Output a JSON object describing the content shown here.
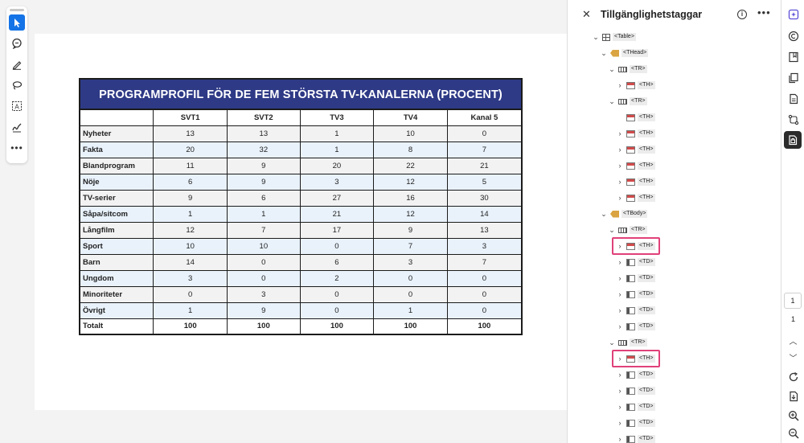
{
  "doc_table": {
    "title": "PROGRAMPROFIL FÖR DE FEM STÖRSTA TV-KANALERNA (PROCENT)",
    "columns": [
      "",
      "SVT1",
      "SVT2",
      "TV3",
      "TV4",
      "Kanal 5"
    ],
    "rows": [
      {
        "label": "Nyheter",
        "values": [
          "13",
          "13",
          "1",
          "10",
          "0"
        ]
      },
      {
        "label": "Fakta",
        "values": [
          "20",
          "32",
          "1",
          "8",
          "7"
        ]
      },
      {
        "label": "Blandprogram",
        "values": [
          "11",
          "9",
          "20",
          "22",
          "21"
        ]
      },
      {
        "label": "Nöje",
        "values": [
          "6",
          "9",
          "3",
          "12",
          "5"
        ]
      },
      {
        "label": "TV-serier",
        "values": [
          "9",
          "6",
          "27",
          "16",
          "30"
        ]
      },
      {
        "label": "Såpa/sitcom",
        "values": [
          "1",
          "1",
          "21",
          "12",
          "14"
        ]
      },
      {
        "label": "Långfilm",
        "values": [
          "12",
          "7",
          "17",
          "9",
          "13"
        ]
      },
      {
        "label": "Sport",
        "values": [
          "10",
          "10",
          "0",
          "7",
          "3"
        ]
      },
      {
        "label": "Barn",
        "values": [
          "14",
          "0",
          "6",
          "3",
          "7"
        ]
      },
      {
        "label": "Ungdom",
        "values": [
          "3",
          "0",
          "2",
          "0",
          "0"
        ]
      },
      {
        "label": "Minoriteter",
        "values": [
          "0",
          "3",
          "0",
          "0",
          "0"
        ]
      },
      {
        "label": "Övrigt",
        "values": [
          "1",
          "9",
          "0",
          "1",
          "0"
        ]
      },
      {
        "label": "Totalt",
        "values": [
          "100",
          "100",
          "100",
          "100",
          "100"
        ]
      }
    ]
  },
  "panel": {
    "title": "Tillgänglighetstaggar",
    "close_icon": "close-icon",
    "info_icon": "info-icon",
    "more_icon": "more-icon"
  },
  "tag_tree": [
    {
      "label": "<Table>",
      "icon": "table",
      "chev": "v",
      "depth": 0,
      "highlighted": false
    },
    {
      "label": "<THead>",
      "icon": "tag",
      "chev": "v",
      "depth": 1,
      "highlighted": false
    },
    {
      "label": "<TR>",
      "icon": "tr",
      "chev": "v",
      "depth": 2,
      "highlighted": false
    },
    {
      "label": "<TH>",
      "icon": "th",
      "chev": ">",
      "depth": 3,
      "highlighted": false
    },
    {
      "label": "<TR>",
      "icon": "tr",
      "chev": "v",
      "depth": 2,
      "highlighted": false
    },
    {
      "label": "<TH>",
      "icon": "th",
      "chev": "",
      "depth": 3,
      "highlighted": false
    },
    {
      "label": "<TH>",
      "icon": "th",
      "chev": ">",
      "depth": 3,
      "highlighted": false
    },
    {
      "label": "<TH>",
      "icon": "th",
      "chev": ">",
      "depth": 3,
      "highlighted": false
    },
    {
      "label": "<TH>",
      "icon": "th",
      "chev": ">",
      "depth": 3,
      "highlighted": false
    },
    {
      "label": "<TH>",
      "icon": "th",
      "chev": ">",
      "depth": 3,
      "highlighted": false
    },
    {
      "label": "<TH>",
      "icon": "th",
      "chev": ">",
      "depth": 3,
      "highlighted": false
    },
    {
      "label": "<TBody>",
      "icon": "tag",
      "chev": "v",
      "depth": 1,
      "highlighted": false
    },
    {
      "label": "<TR>",
      "icon": "tr",
      "chev": "v",
      "depth": 2,
      "highlighted": false
    },
    {
      "label": "<TH>",
      "icon": "th",
      "chev": ">",
      "depth": 3,
      "highlighted": true
    },
    {
      "label": "<TD>",
      "icon": "td",
      "chev": ">",
      "depth": 3,
      "highlighted": false
    },
    {
      "label": "<TD>",
      "icon": "td",
      "chev": ">",
      "depth": 3,
      "highlighted": false
    },
    {
      "label": "<TD>",
      "icon": "td",
      "chev": ">",
      "depth": 3,
      "highlighted": false
    },
    {
      "label": "<TD>",
      "icon": "td",
      "chev": ">",
      "depth": 3,
      "highlighted": false
    },
    {
      "label": "<TD>",
      "icon": "td",
      "chev": ">",
      "depth": 3,
      "highlighted": false
    },
    {
      "label": "<TR>",
      "icon": "tr",
      "chev": "v",
      "depth": 2,
      "highlighted": false
    },
    {
      "label": "<TH>",
      "icon": "th",
      "chev": ">",
      "depth": 3,
      "highlighted": true
    },
    {
      "label": "<TD>",
      "icon": "td",
      "chev": ">",
      "depth": 3,
      "highlighted": false
    },
    {
      "label": "<TD>",
      "icon": "td",
      "chev": ">",
      "depth": 3,
      "highlighted": false
    },
    {
      "label": "<TD>",
      "icon": "td",
      "chev": ">",
      "depth": 3,
      "highlighted": false
    },
    {
      "label": "<TD>",
      "icon": "td",
      "chev": ">",
      "depth": 3,
      "highlighted": false
    },
    {
      "label": "<TD>",
      "icon": "td",
      "chev": ">",
      "depth": 3,
      "highlighted": false
    }
  ],
  "left_tools": [
    "select-icon",
    "comment-icon",
    "pen-icon",
    "lasso-icon",
    "text-select-icon",
    "signature-icon",
    "more-tools-icon"
  ],
  "right_tools": [
    "ai-assistant-icon",
    "copy-icon",
    "bookmark-icon",
    "pages-icon",
    "document-icon",
    "transform-icon",
    "accessibility-tags-icon"
  ],
  "pager": {
    "current": "1",
    "total": "1"
  },
  "colors": {
    "accent": "#1473e6",
    "table_title_bg": "#2e3a86",
    "highlight": "#e0417a"
  }
}
